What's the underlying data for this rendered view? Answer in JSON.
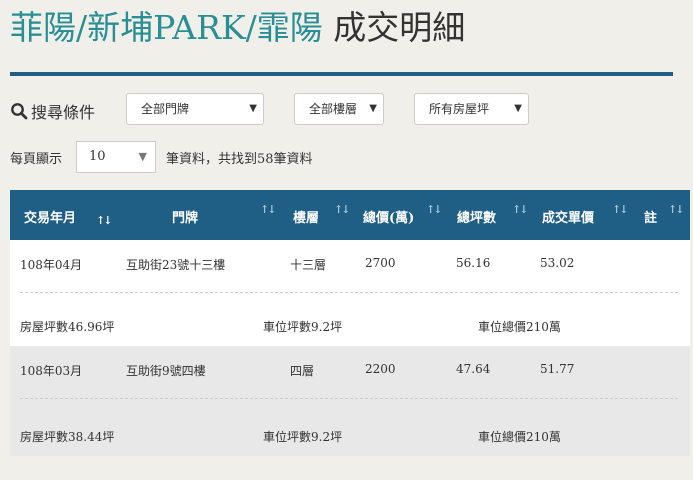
{
  "page": {
    "title_place": "菲陽/新埔PARK/霏陽",
    "title_suffix": "成交明細"
  },
  "filters": {
    "label": "搜尋條件",
    "address_select": "全部門牌",
    "floor_select": "全部樓層",
    "area_select": "所有房屋坪"
  },
  "paging": {
    "per_page_label": "每頁顯示",
    "per_page_value": "10",
    "result_text": "筆資料，共找到58筆資料"
  },
  "table": {
    "headers": {
      "date": "交易年月",
      "address": "門牌",
      "floor": "樓層",
      "total_price": "總價(萬)",
      "total_area": "總坪數",
      "unit_price": "成交單價",
      "note": "註"
    },
    "rows": [
      {
        "date": "108年04月",
        "address": "互助街23號十三樓",
        "floor": "十三層",
        "total_price": "2700",
        "total_area": "56.16",
        "unit_price": "53.02",
        "house_area": "房屋坪數46.96坪",
        "parking_area": "車位坪數9.2坪",
        "parking_price": "車位總價210萬"
      },
      {
        "date": "108年03月",
        "address": "互助街9號四樓",
        "floor": "四層",
        "total_price": "2200",
        "total_area": "47.64",
        "unit_price": "51.77",
        "house_area": "房屋坪數38.44坪",
        "parking_area": "車位坪數9.2坪",
        "parking_price": "車位總價210萬"
      }
    ]
  },
  "colors": {
    "accent": "#2a8f95",
    "header_bg": "#1f5f86"
  }
}
